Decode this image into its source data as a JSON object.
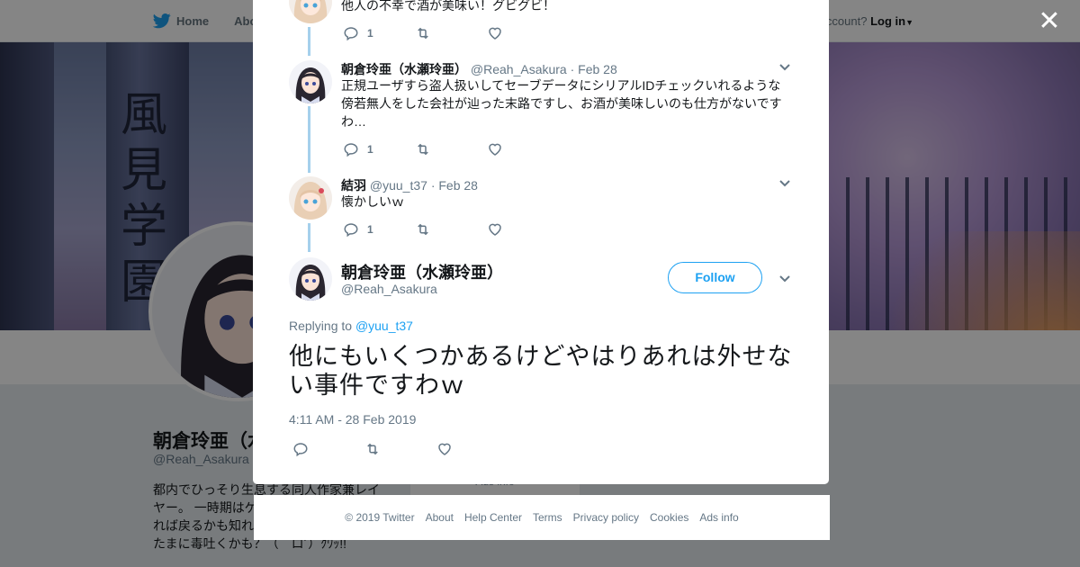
{
  "nav": {
    "home_label": "Home",
    "about_label": "Abo",
    "account_prompt": "ccount?",
    "login_label": "Log in"
  },
  "profile": {
    "banner_text": "風見学園",
    "name": "朝倉玲亜（水",
    "handle": "@Reah_Asakura",
    "bio": "都内でひっそり生息する同人作家兼レイヤー。 一時期はゲ…けど今は現役では…れば戻るかも知れないっぽい？ あ、極々たまに毒吐くかも？（｀ロ´）ｸﾜｯ!!",
    "card_peek_text": "Ads info"
  },
  "thread": [
    {
      "name": "",
      "handle": "",
      "date": "",
      "text": "他人の不幸で酒が美味い！グビグビ！",
      "reply_count": "1",
      "avatar": "blonde-girl-avatar"
    },
    {
      "name": "朝倉玲亜（水瀬玲亜）",
      "handle": "@Reah_Asakura",
      "date": "· Feb 28",
      "text": "正規ユーザすら盗人扱いしてセーブデータにシリアルIDチェックいれるような傍若無人をした会社が辿った末路ですし、お酒が美味しいのも仕方がないですわ…",
      "reply_count": "1",
      "avatar": "dark-hair-girl-avatar"
    },
    {
      "name": "結羽",
      "handle": "@yuu_t37",
      "date": "· Feb 28",
      "text": "懐かしいｗ",
      "reply_count": "1",
      "avatar": "blonde-girl-avatar"
    }
  ],
  "main_tweet": {
    "name": "朝倉玲亜（水瀬玲亜）",
    "handle": "@Reah_Asakura",
    "follow_label": "Follow",
    "replying_prefix": "Replying to",
    "replying_to": "@yuu_t37",
    "text": "他にもいくつかあるけどやはりあれは外せない事件ですわｗ",
    "timestamp": "4:11 AM - 28 Feb 2019"
  },
  "footer": [
    "© 2019 Twitter",
    "About",
    "Help Center",
    "Terms",
    "Privacy policy",
    "Cookies",
    "Ads info"
  ],
  "colors": {
    "twitter_blue": "#1da1f2",
    "thread_line": "#a5d0ec",
    "muted_text": "#657786"
  }
}
